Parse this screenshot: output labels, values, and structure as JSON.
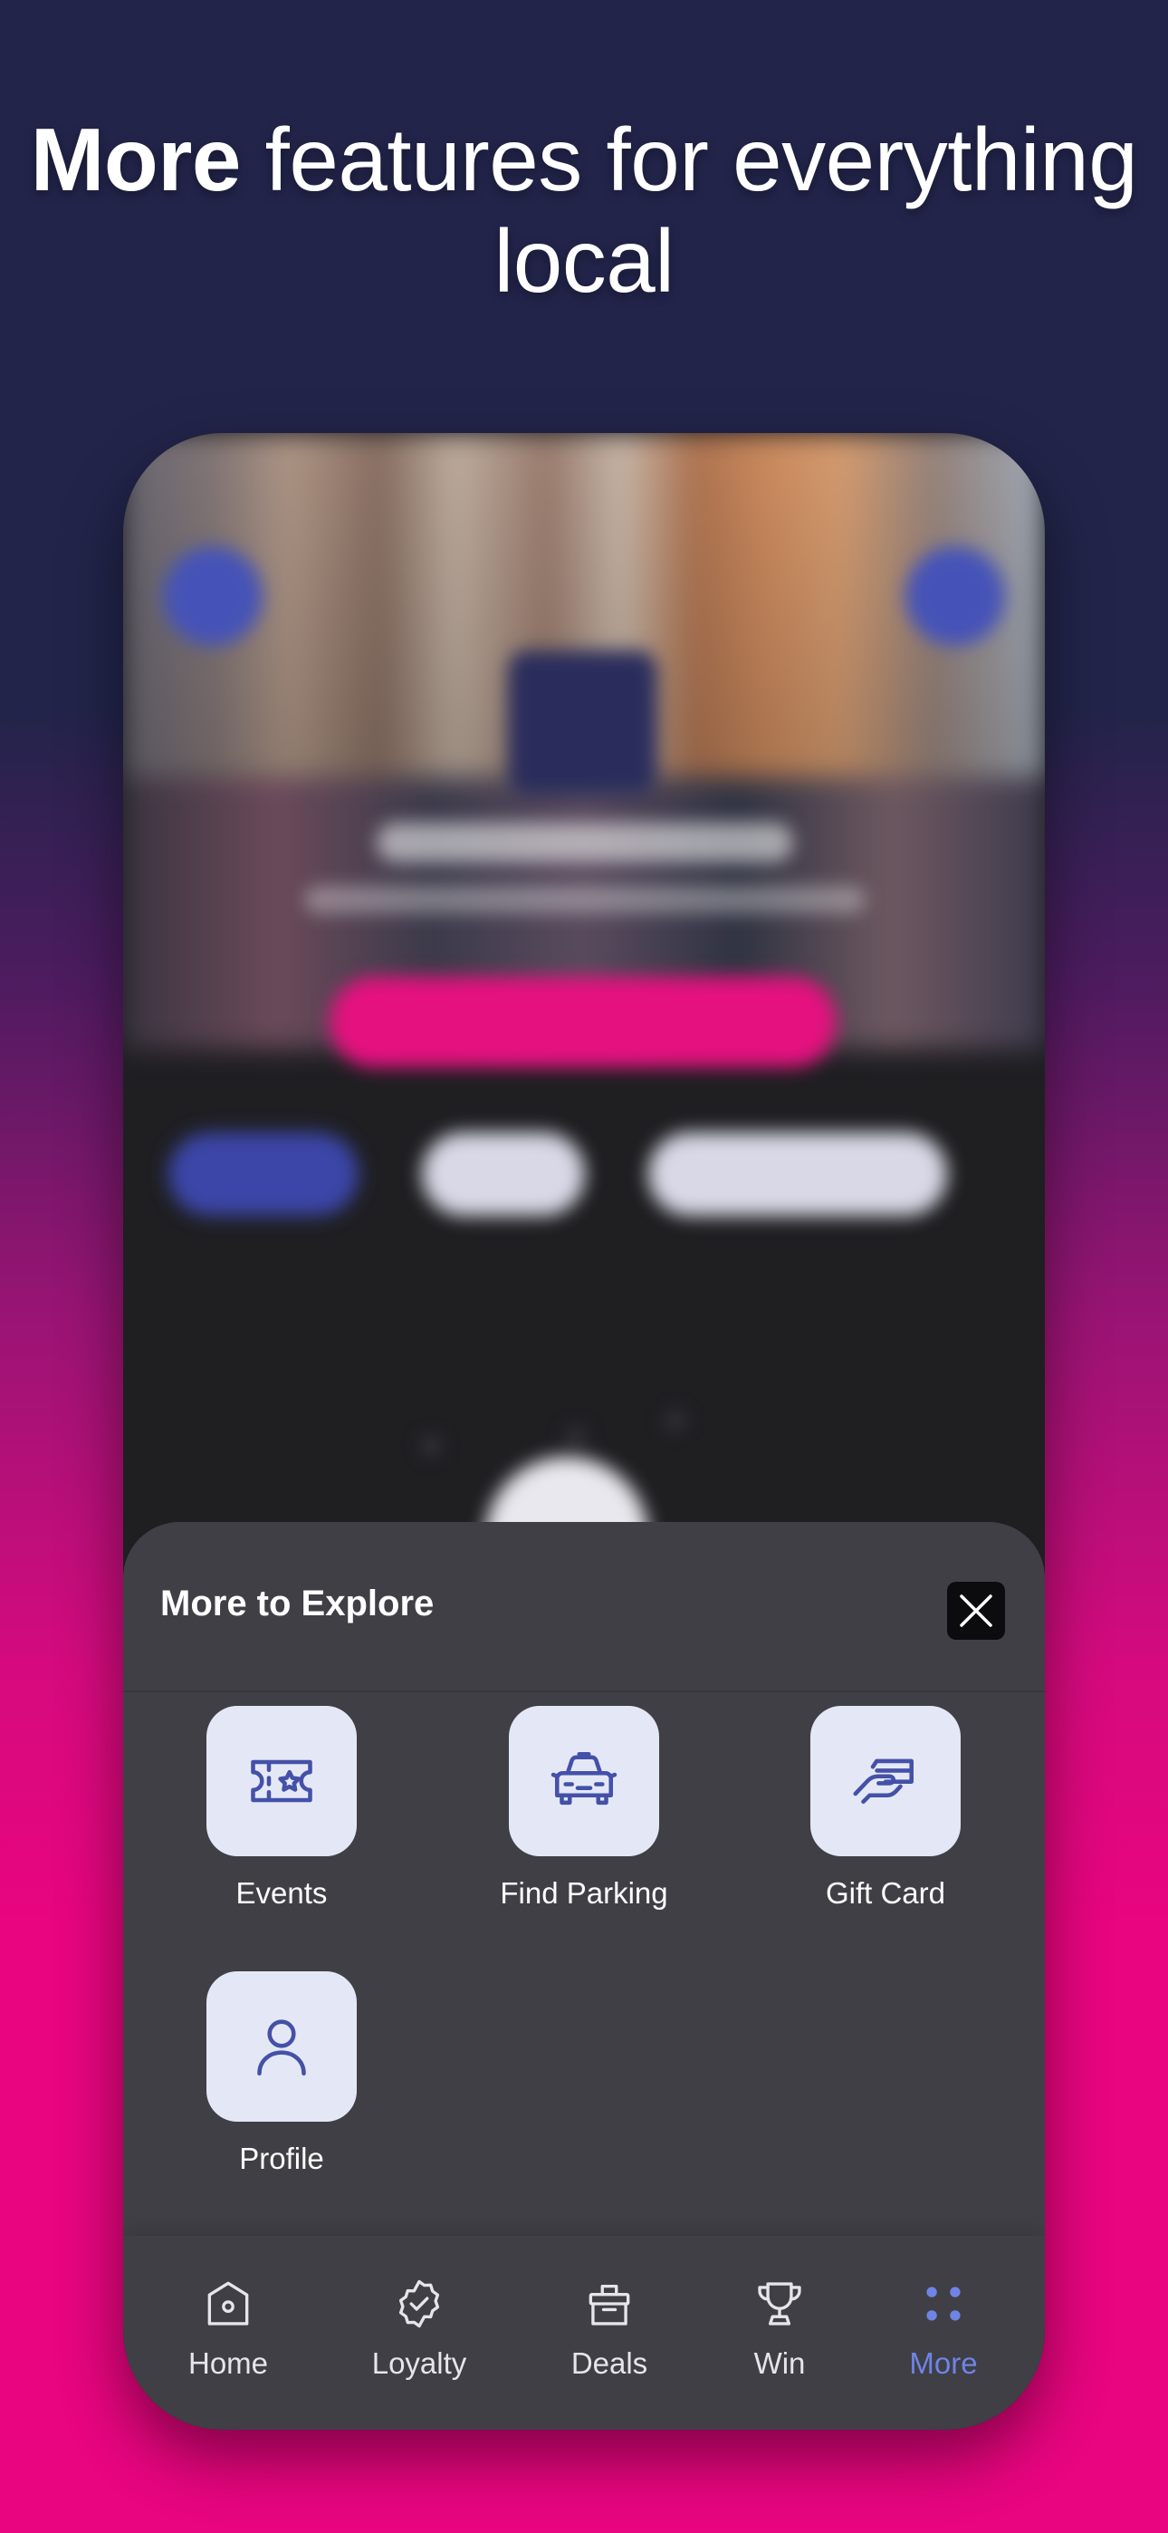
{
  "headline": {
    "bold": "More",
    "rest": "features for everything local"
  },
  "sheet": {
    "title": "More to Explore",
    "items": [
      {
        "label": "Events",
        "icon": "ticket-icon"
      },
      {
        "label": "Find Parking",
        "icon": "car-icon"
      },
      {
        "label": "Gift Card",
        "icon": "gift-card-icon"
      },
      {
        "label": "Profile",
        "icon": "user-icon"
      }
    ]
  },
  "tabs": [
    {
      "label": "Home",
      "icon": "home-icon",
      "active": false
    },
    {
      "label": "Loyalty",
      "icon": "badge-check-icon",
      "active": false
    },
    {
      "label": "Deals",
      "icon": "gift-box-icon",
      "active": false
    },
    {
      "label": "Win",
      "icon": "trophy-icon",
      "active": false
    },
    {
      "label": "More",
      "icon": "grid-dots-icon",
      "active": true
    }
  ],
  "colors": {
    "accent": "#6f84e4",
    "icon_stroke": "#4451a8",
    "tile_bg": "#e4e8f6",
    "sheet_bg": "#3f3f45",
    "brand_pink": "#e5117f"
  }
}
